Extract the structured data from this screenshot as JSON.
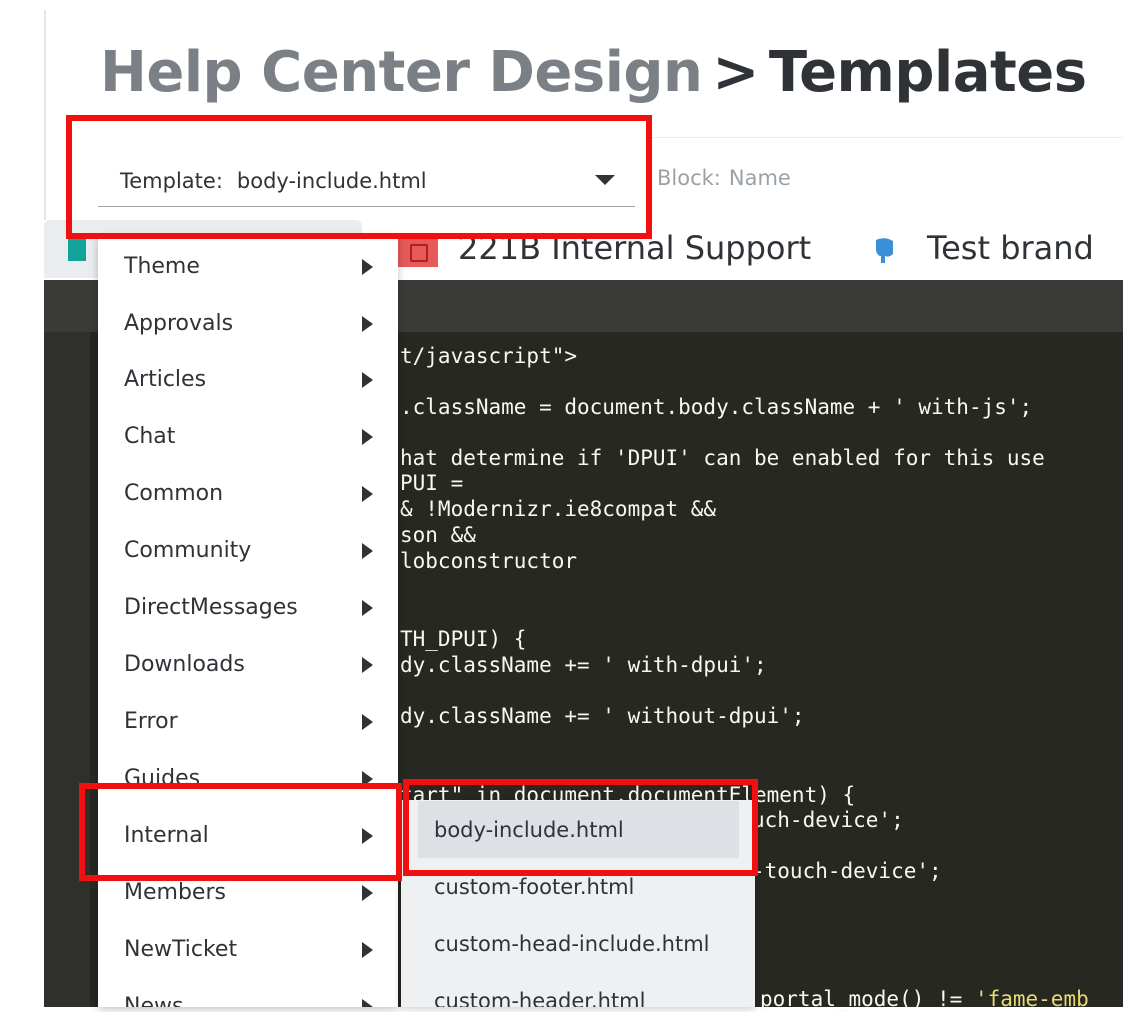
{
  "header": {
    "breadcrumb": "Help Center Design",
    "separator": ">",
    "title": "Templates"
  },
  "template_select": {
    "label": "Template:",
    "value": "body-include.html"
  },
  "block_field": {
    "label": "Block:",
    "value": "Name"
  },
  "brands": [
    {
      "label": "221B Internal Support",
      "icon": "221b-logo-icon"
    },
    {
      "label": "Test brand",
      "icon": "elephant-logo-icon"
    }
  ],
  "code_lines": [
    "t/javascript\">",
    ".className = document.body.className + ' with-js';",
    "hat determine if 'DPUI' can be enabled for this use",
    "PUI =",
    "& !Modernizr.ie8compat &&",
    "son &&",
    "lobconstructor",
    "TH_DPUI) {",
    "dy.className += ' with-dpui';",
    "dy.className += ' without-dpui';",
    "tart\" in document.documentElement) {",
    "uch-device';",
    "-touch-device';",
    "portal_mode() != "
  ],
  "code_string_tail": "'fame-emb",
  "menu": {
    "items": [
      "Theme",
      "Approvals",
      "Articles",
      "Chat",
      "Common",
      "Community",
      "DirectMessages",
      "Downloads",
      "Error",
      "Guides",
      "Internal",
      "Members",
      "NewTicket",
      "News"
    ]
  },
  "submenu": {
    "items": [
      "body-include.html",
      "custom-footer.html",
      "custom-head-include.html",
      "custom-header.html"
    ],
    "selected": "body-include.html"
  },
  "colors": {
    "highlight": "#f20f0f",
    "editor_bg": "#272822",
    "title_muted": "#7a8085",
    "title_dark": "#2f3337"
  }
}
